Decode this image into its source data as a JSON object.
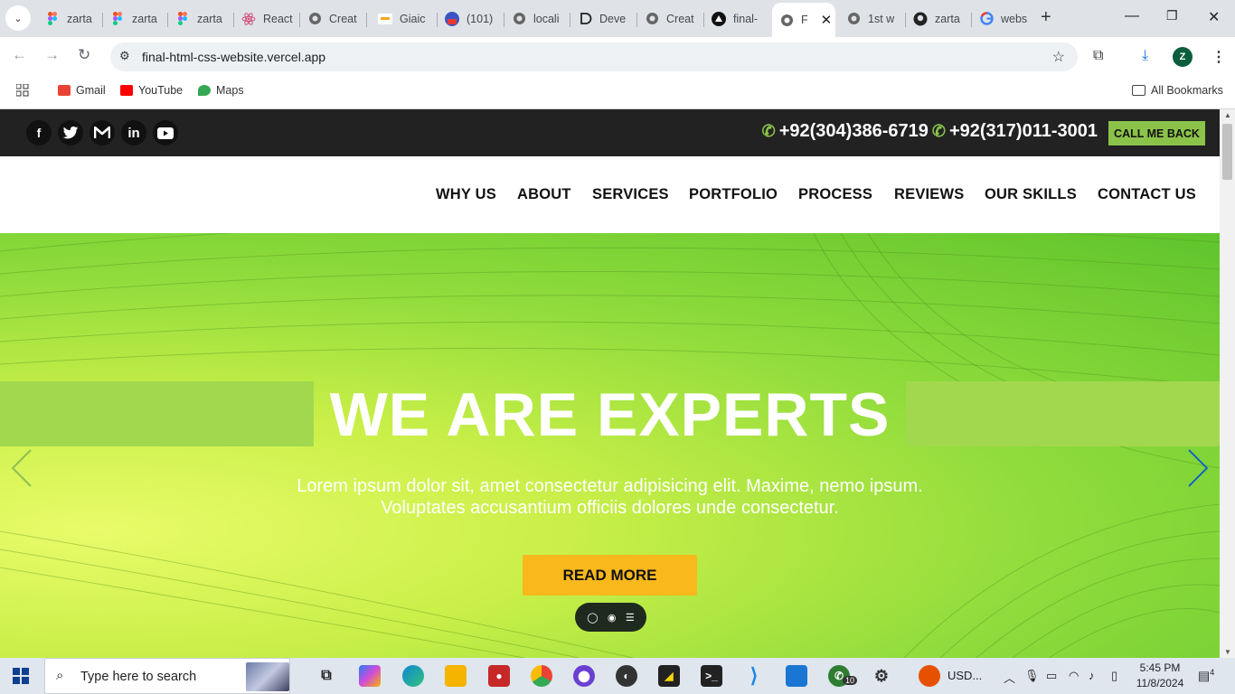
{
  "browser": {
    "tabs": [
      {
        "label": "zarta",
        "icon": "figma-icon"
      },
      {
        "label": "zarta",
        "icon": "figma-icon"
      },
      {
        "label": "zarta",
        "icon": "figma-icon"
      },
      {
        "label": "React",
        "icon": "react-icon"
      },
      {
        "label": "Creat",
        "icon": "globe-icon"
      },
      {
        "label": "Giaic",
        "icon": "giaic-icon"
      },
      {
        "label": "(101)",
        "icon": "youtube-icon"
      },
      {
        "label": "locali",
        "icon": "globe-icon"
      },
      {
        "label": "Deve",
        "icon": "dev-icon"
      },
      {
        "label": "Creat",
        "icon": "globe-icon"
      },
      {
        "label": "final-",
        "icon": "vercel-icon"
      },
      {
        "label": "F",
        "icon": "globe-icon",
        "active": true
      },
      {
        "label": "1st w",
        "icon": "globe-icon"
      },
      {
        "label": "zarta",
        "icon": "github-icon"
      },
      {
        "label": "webs",
        "icon": "google-icon"
      }
    ],
    "url": "final-html-css-website.vercel.app",
    "profile_initial": "Z",
    "bookmarks": [
      {
        "label": "Gmail",
        "color": "#ea4335"
      },
      {
        "label": "YouTube",
        "color": "#ff0000"
      },
      {
        "label": "Maps",
        "color": "#34a853"
      }
    ],
    "all_bookmarks": "All Bookmarks"
  },
  "site": {
    "social_icons": [
      "facebook-icon",
      "twitter-icon",
      "gmail-icon",
      "linkedin-icon",
      "youtube-icon"
    ],
    "phones": [
      "+92(304)386-6719",
      "+92(317)011-3001"
    ],
    "call_back": "CALL ME BACK",
    "nav": [
      "WHY US",
      "ABOUT",
      "SERVICES",
      "PORTFOLIO",
      "PROCESS",
      "REVIEWS",
      "OUR SKILLS",
      "CONTACT US"
    ],
    "hero": {
      "title": "WE ARE EXPERTS",
      "text_line1": "Lorem ipsum dolor sit, amet consectetur adipisicing elit. Maxime, nemo ipsum.",
      "text_line2": "Voluptates accusantium officiis dolores unde consectetur.",
      "button": "READ MORE"
    },
    "colors": {
      "accent": "#8bc34a",
      "button": "#f9b81c",
      "topbar": "#222222"
    }
  },
  "taskbar": {
    "search_placeholder": "Type here to search",
    "whatsapp_badge": "10",
    "tray_label": "USD...",
    "time": "5:45 PM",
    "date": "11/8/2024",
    "notifications": "4"
  }
}
